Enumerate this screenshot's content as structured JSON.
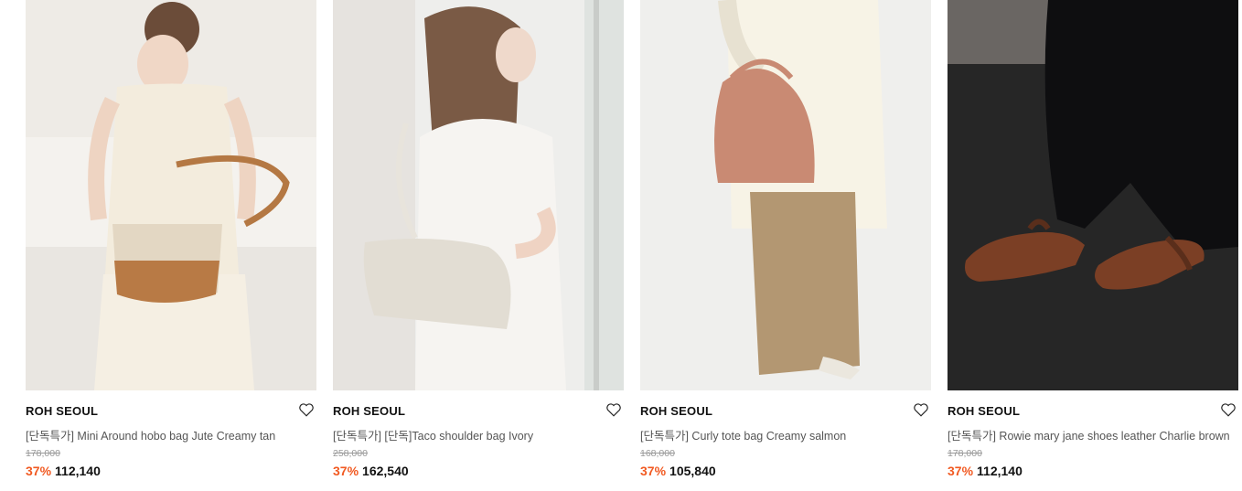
{
  "products": [
    {
      "brand": "ROH SEOUL",
      "name": "[단독특가] Mini Around hobo bag Jute Creamy tan",
      "original_price": "178,000",
      "discount": "37%",
      "price": "112,140",
      "wishlist_icon": "heart-outline-icon"
    },
    {
      "brand": "ROH SEOUL",
      "name": "[단독특가] [단독]Taco shoulder bag Ivory",
      "original_price": "258,000",
      "discount": "37%",
      "price": "162,540",
      "wishlist_icon": "heart-outline-icon"
    },
    {
      "brand": "ROH SEOUL",
      "name": "[단독특가] Curly tote bag Creamy salmon",
      "original_price": "168,000",
      "discount": "37%",
      "price": "105,840",
      "wishlist_icon": "heart-outline-icon"
    },
    {
      "brand": "ROH SEOUL",
      "name": "[단독특가] Rowie mary jane shoes leather Charlie brown",
      "original_price": "178,000",
      "discount": "37%",
      "price": "112,140",
      "wishlist_icon": "heart-outline-icon"
    }
  ],
  "colors": {
    "discount": "#f15a22",
    "original_price": "#999999",
    "name": "#555555"
  }
}
